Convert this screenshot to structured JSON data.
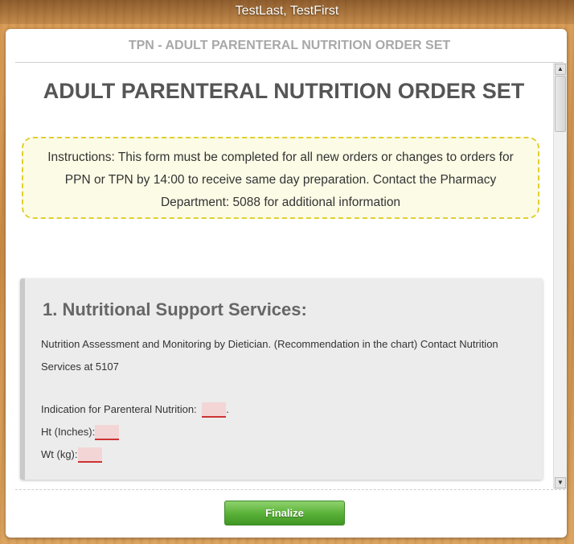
{
  "window": {
    "title": "TestLast, TestFirst"
  },
  "header": {
    "title": "TPN - ADULT PARENTERAL NUTRITION ORDER SET"
  },
  "main": {
    "title": "ADULT PARENTERAL NUTRITION ORDER SET",
    "instructions": "Instructions: This form must be completed for all new orders or changes to orders for PPN or TPN by 14:00 to receive same day preparation. Contact the Pharmacy Department: 5088 for additional information"
  },
  "section1": {
    "title": "1. Nutritional Support Services:",
    "text": "Nutrition Assessment and Monitoring by Dietician. (Recommendation in the chart) Contact Nutrition Services at 5107",
    "indication_label": "Indication for Parenteral Nutrition:",
    "indication_suffix": ".",
    "height_label": "Ht (Inches):",
    "weight_label": "Wt (kg):"
  },
  "footer": {
    "finalize_label": "Finalize"
  },
  "colors": {
    "accent": "#5cb33a",
    "required_field": "#f3d5d5",
    "required_border": "#cc3333"
  }
}
